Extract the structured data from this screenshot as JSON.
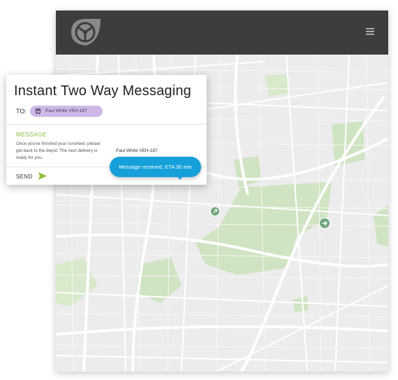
{
  "app": {
    "logo_icon": "steering-wheel-icon",
    "menu_icon": "hamburger-menu-icon"
  },
  "card": {
    "title": "Instant Two Way Messaging",
    "to_label": "TO:",
    "recipient": {
      "icon": "bus-icon",
      "text": "Paul White VEH-187"
    },
    "message_label": "MESSAGE",
    "message_body": "Once you've finished your runsheet, please get back to the depot. The next delivery is ready for you.",
    "send_label": "SEND",
    "send_icon": "send-arrow-icon"
  },
  "reply": {
    "sender": "Paul White VEH-187",
    "text": "Message received, ETA 30 min"
  },
  "map": {
    "markers": [
      {
        "name": "vehicle-marker-1",
        "icon": "arrow-icon"
      },
      {
        "name": "vehicle-marker-2",
        "icon": "arrow-icon"
      }
    ]
  },
  "colors": {
    "topbar": "#3d3d3d",
    "accent_green": "#8dbf3c",
    "bubble_blue": "#16a0da",
    "chip_purple": "#cdb8e6",
    "map_park": "#cfe4c2"
  }
}
